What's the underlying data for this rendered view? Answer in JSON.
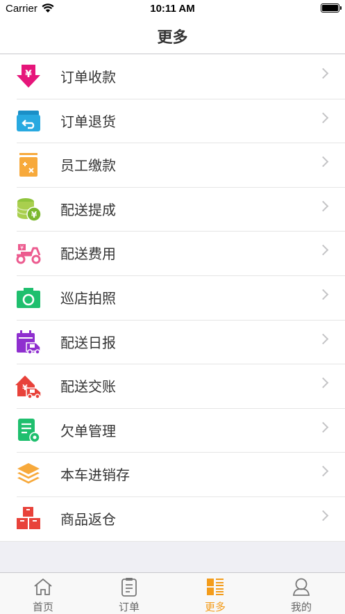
{
  "status": {
    "carrier": "Carrier",
    "time": "10:11 AM"
  },
  "header": {
    "title": "更多"
  },
  "menu": [
    {
      "label": "订单收款",
      "icon": "download-payment-icon"
    },
    {
      "label": "订单退货",
      "icon": "return-box-icon"
    },
    {
      "label": "员工缴款",
      "icon": "calculator-icon"
    },
    {
      "label": "配送提成",
      "icon": "coins-icon"
    },
    {
      "label": "配送费用",
      "icon": "scooter-icon"
    },
    {
      "label": "巡店拍照",
      "icon": "camera-icon"
    },
    {
      "label": "配送日报",
      "icon": "calendar-truck-icon"
    },
    {
      "label": "配送交账",
      "icon": "house-truck-icon"
    },
    {
      "label": "欠单管理",
      "icon": "document-gear-icon"
    },
    {
      "label": "本车进销存",
      "icon": "layers-icon"
    },
    {
      "label": "商品返仓",
      "icon": "boxes-icon"
    }
  ],
  "tabs": [
    {
      "label": "首页",
      "icon": "home-icon"
    },
    {
      "label": "订单",
      "icon": "clipboard-icon"
    },
    {
      "label": "更多",
      "icon": "grid-list-icon",
      "active": true
    },
    {
      "label": "我的",
      "icon": "user-icon"
    }
  ],
  "colors": {
    "active_tab": "#f39c1b",
    "magenta": "#e6157a",
    "blue": "#28a9e0",
    "orange": "#f7a93b",
    "green": "#a9cf4e",
    "pink": "#ec5b8f",
    "teal": "#1fbf6e",
    "purple": "#8f2fcf",
    "red": "#e8423a"
  }
}
